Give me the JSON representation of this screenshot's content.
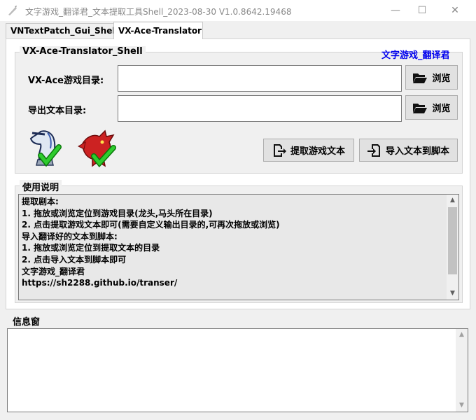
{
  "window": {
    "title": "文字游戏_翻译君_文本提取工具Shell_2023-08-30   V1.0.8642.19468",
    "minimize": "—",
    "maximize": "☐",
    "close": "✕"
  },
  "tabs": [
    {
      "label": "VNTextPatch_Gui_Shell",
      "active": false
    },
    {
      "label": "VX-Ace-Translator",
      "active": true
    }
  ],
  "shell_group": {
    "title": "VX-Ace-Translator_Shell",
    "brand_link": "文字游戏_翻译君",
    "game_dir_label": "VX-Ace游戏目录:",
    "game_dir_value": "",
    "export_dir_label": "导出文本目录:",
    "export_dir_value": "",
    "browse_label": "浏览",
    "extract_button": "提取游戏文本",
    "import_button": "导入文本到脚本"
  },
  "usage_group": {
    "title": "使用说明",
    "lines": [
      "提取剧本:",
      "1. 拖放或浏览定位到游戏目录(龙头,马头所在目录)",
      "2. 点击提取游戏文本即可(需要自定义输出目录的,可再次拖放或浏览)",
      "导入翻译好的文本到脚本:",
      "1. 拖放或浏览定位到提取文本的目录",
      "2. 点击导入文本到脚本即可",
      "文字游戏_翻译君",
      "https://sh2288.github.io/transer/"
    ]
  },
  "info_group": {
    "title": "信息窗",
    "content": ""
  },
  "icons": {
    "folder": "folder-open-icon",
    "extract": "file-export-icon",
    "import": "file-import-icon",
    "horse": "chess-knight-check-icon",
    "dragon": "dragon-check-icon"
  },
  "colors": {
    "link": "#0000ee",
    "check": "#22aa22",
    "dragon": "#cc2222"
  }
}
